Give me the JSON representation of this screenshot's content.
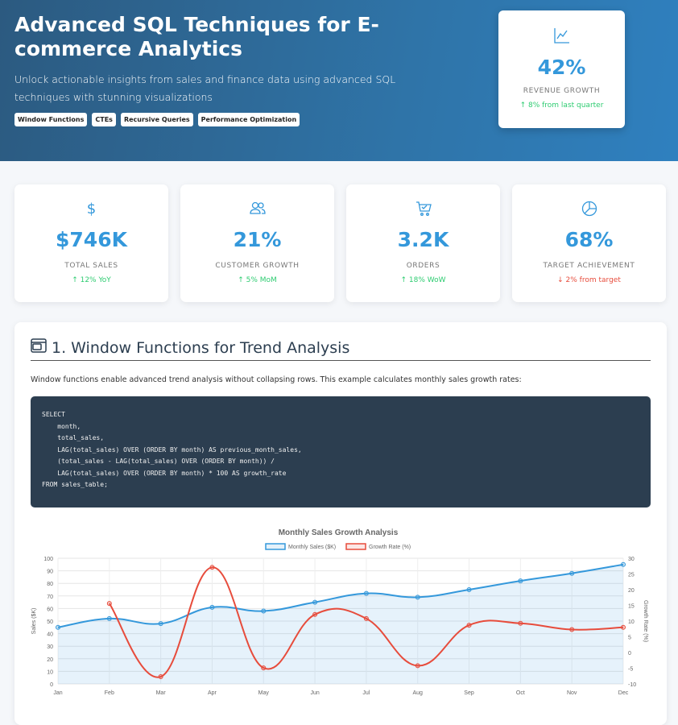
{
  "hero": {
    "title": "Advanced SQL Techniques for E-commerce Analytics",
    "subtitle": "Unlock actionable insights from sales and finance data using advanced SQL techniques with stunning visualizations",
    "tags": [
      "Window Functions",
      "CTEs",
      "Recursive Queries",
      "Performance Optimization"
    ],
    "card": {
      "icon": "line-chart-icon",
      "value": "42%",
      "label": "REVENUE GROWTH",
      "delta": "↑ 8% from last quarter"
    }
  },
  "stats": [
    {
      "icon": "dollar-icon",
      "value": "$746K",
      "label": "TOTAL SALES",
      "delta": "↑ 12% YoY",
      "trend": "up"
    },
    {
      "icon": "users-icon",
      "value": "21%",
      "label": "CUSTOMER GROWTH",
      "delta": "↑ 5% MoM",
      "trend": "up"
    },
    {
      "icon": "cart-icon",
      "value": "3.2K",
      "label": "ORDERS",
      "delta": "↑ 18% WoW",
      "trend": "up"
    },
    {
      "icon": "pie-chart-icon",
      "value": "68%",
      "label": "TARGET ACHIEVEMENT",
      "delta": "↓ 2% from target",
      "trend": "down"
    }
  ],
  "section": {
    "title": "1. Window Functions for Trend Analysis",
    "description": "Window functions enable advanced trend analysis without collapsing rows. This example calculates monthly sales growth rates:",
    "code": "SELECT\n    month,\n    total_sales,\n    LAG(total_sales) OVER (ORDER BY month) AS previous_month_sales,\n    (total_sales - LAG(total_sales) OVER (ORDER BY month)) /\n    LAG(total_sales) OVER (ORDER BY month) * 100 AS growth_rate\nFROM sales_table;"
  },
  "chart_data": {
    "type": "line",
    "title": "Monthly Sales Growth Analysis",
    "categories": [
      "Jan",
      "Feb",
      "Mar",
      "Apr",
      "May",
      "Jun",
      "Jul",
      "Aug",
      "Sep",
      "Oct",
      "Nov",
      "Dec"
    ],
    "series": [
      {
        "name": "Monthly Sales ($K)",
        "axis": "left",
        "color": "#3498db",
        "values": [
          45,
          52,
          48,
          61,
          58,
          65,
          72,
          69,
          75,
          82,
          88,
          95
        ]
      },
      {
        "name": "Growth Rate (%)",
        "axis": "right",
        "color": "#e74c3c",
        "values": [
          null,
          15.6,
          -7.7,
          27.1,
          -4.9,
          12.1,
          10.8,
          -4.2,
          8.7,
          9.3,
          7.3,
          8.0
        ]
      }
    ],
    "ylabel": "Sales ($K)",
    "y2label": "Growth Rate (%)",
    "ylim": [
      0,
      100
    ],
    "y2lim": [
      -10,
      30
    ],
    "yticks": [
      0,
      10,
      20,
      30,
      40,
      50,
      60,
      70,
      80,
      90,
      100
    ],
    "y2ticks": [
      -10,
      -5,
      0,
      5,
      10,
      15,
      20,
      25,
      30
    ],
    "legend": "top",
    "grid": true
  }
}
